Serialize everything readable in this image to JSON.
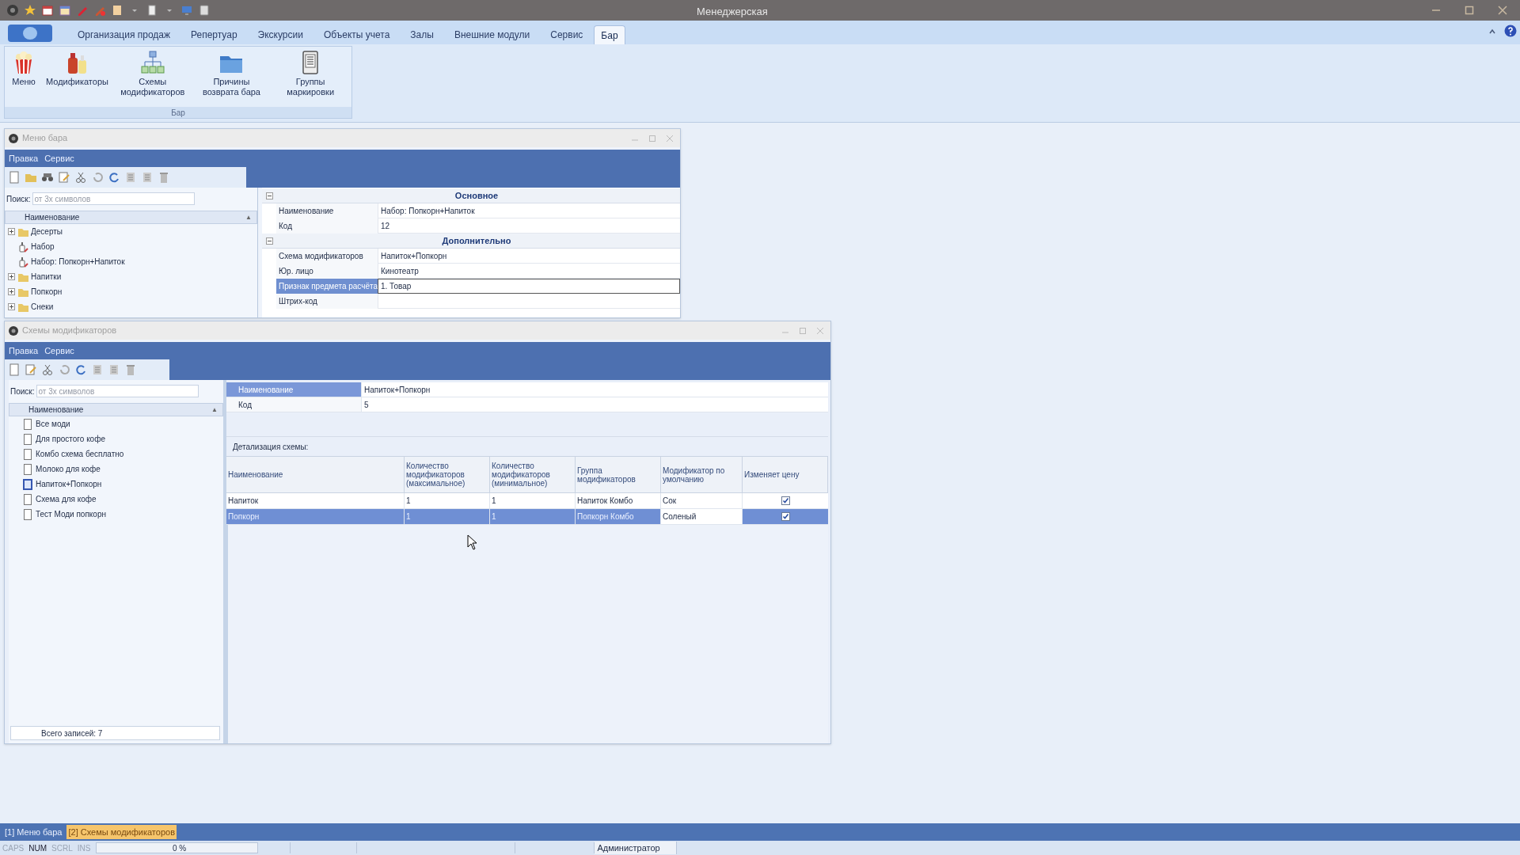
{
  "window": {
    "title": "Менеджерская"
  },
  "ribbon": {
    "tabs": [
      {
        "label": "Организация продаж",
        "selected": false
      },
      {
        "label": "Репертуар",
        "selected": false
      },
      {
        "label": "Экскурсии",
        "selected": false
      },
      {
        "label": "Объекты учета",
        "selected": false
      },
      {
        "label": "Залы",
        "selected": false
      },
      {
        "label": "Внешние модули",
        "selected": false
      },
      {
        "label": "Сервис",
        "selected": false
      },
      {
        "label": "Бар",
        "selected": true
      }
    ],
    "group": {
      "label": "Бар",
      "buttons": [
        {
          "label": "Меню",
          "kind": "popcorn"
        },
        {
          "label": "Модификаторы",
          "kind": "bottles"
        },
        {
          "label": "Схемы модификаторов",
          "kind": "hierarchy"
        },
        {
          "label": "Причины возврата бара",
          "kind": "folder"
        },
        {
          "label": "Группы маркировки",
          "kind": "device"
        }
      ]
    }
  },
  "menu_window": {
    "title": "Меню бара",
    "menu": [
      "Правка",
      "Сервис"
    ],
    "search": {
      "label": "Поиск:",
      "placeholder": "от 3х символов"
    },
    "tree": {
      "column": "Наименование",
      "sort": "▲",
      "items": [
        {
          "label": "Десерты",
          "kind": "folder"
        },
        {
          "label": "Набор",
          "kind": "set"
        },
        {
          "label": "Набор: Попкорн+Напиток",
          "kind": "set"
        },
        {
          "label": "Напитки",
          "kind": "folder"
        },
        {
          "label": "Попкорн",
          "kind": "folder"
        },
        {
          "label": "Снеки",
          "kind": "folder"
        }
      ]
    },
    "properties": [
      {
        "title": "Основное",
        "expanded": true,
        "rows": [
          {
            "label": "Наименование",
            "value": "Набор: Попкорн+Напиток",
            "selected": false
          },
          {
            "label": "Код",
            "value": "12",
            "selected": false
          }
        ]
      },
      {
        "title": "Дополнительно",
        "expanded": true,
        "rows": [
          {
            "label": "Схема модификаторов",
            "value": "Напиток+Попкорн",
            "selected": false
          },
          {
            "label": "Юр. лицо",
            "value": "Кинотеатр",
            "selected": false
          },
          {
            "label": "Признак предмета расчёта",
            "value": "1. Товар",
            "selected": true
          },
          {
            "label": "Штрих-код",
            "value": "",
            "selected": false
          }
        ]
      }
    ]
  },
  "schemes_window": {
    "title": "Схемы модификаторов",
    "menu": [
      "Правка",
      "Сервис"
    ],
    "search": {
      "label": "Поиск:",
      "placeholder": "от 3х символов"
    },
    "list": {
      "column": "Наименование",
      "sort": "▲",
      "items": [
        {
          "label": "Все моди",
          "selected": false
        },
        {
          "label": "Для простого кофе",
          "selected": false
        },
        {
          "label": "Комбо схема бесплатно",
          "selected": false
        },
        {
          "label": "Молоко для кофе",
          "selected": false
        },
        {
          "label": "Напиток+Попкорн",
          "selected": true
        },
        {
          "label": "Схема для кофе",
          "selected": false
        },
        {
          "label": "Тест Моди попкорн",
          "selected": false
        }
      ]
    },
    "total": "Всего записей: 7",
    "fields": [
      {
        "label": "Наименование",
        "value": "Напиток+Попкорн",
        "selected": true
      },
      {
        "label": "Код",
        "value": "5",
        "selected": false
      }
    ],
    "details_label": "Детализация схемы:",
    "grid": {
      "columns": [
        "Наименование",
        "Количество модификаторов (максимальное)",
        "Количество модификаторов (минимальное)",
        "Группа модификаторов",
        "Модификатор по умолчанию",
        "Изменяет цену"
      ],
      "rows": [
        {
          "cells": [
            "Напиток",
            "1",
            "1",
            "Напиток Комбо",
            "Сок"
          ],
          "checked": true,
          "selected": false
        },
        {
          "cells": [
            "Попкорн",
            "1",
            "1",
            "Попкорн Комбо",
            "Соленый"
          ],
          "checked": true,
          "selected": true
        }
      ]
    }
  },
  "taskbar": [
    {
      "label": "[1] Меню бара",
      "selected": false
    },
    {
      "label": "[2] Схемы модификаторов",
      "selected": true
    }
  ],
  "status_bar": {
    "keys": [
      {
        "label": "CAPS",
        "on": false
      },
      {
        "label": "NUM",
        "on": true
      },
      {
        "label": "SCRL",
        "on": false
      },
      {
        "label": "INS",
        "on": false
      }
    ],
    "progress": {
      "level": 0,
      "text": "0 %"
    },
    "user": "Администратор"
  }
}
